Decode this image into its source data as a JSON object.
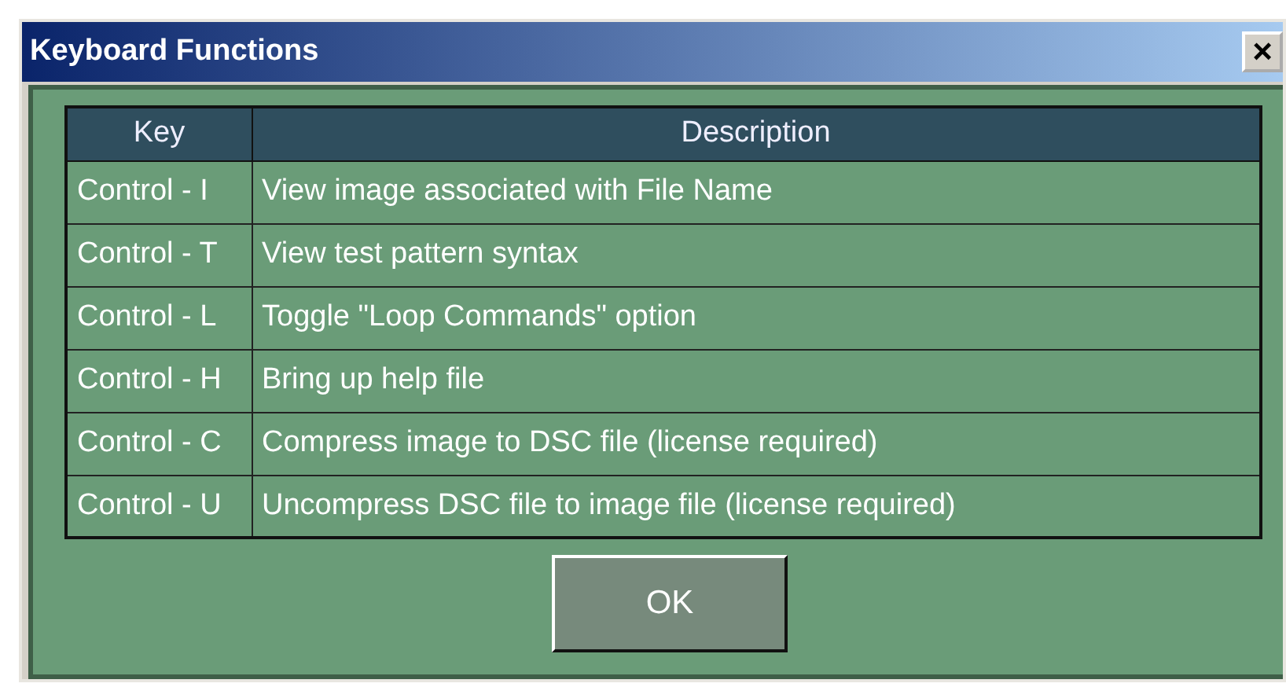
{
  "window": {
    "title": "Keyboard Functions",
    "close": "×"
  },
  "table": {
    "columns": [
      "Key",
      "Description"
    ],
    "rows": [
      [
        "Control - I",
        "View image associated with File Name"
      ],
      [
        "Control - T",
        "View test pattern syntax"
      ],
      [
        "Control - L",
        "Toggle \"Loop Commands\" option"
      ],
      [
        "Control - H",
        "Bring up help file"
      ],
      [
        "Control - C",
        "Compress image to DSC file (license required)"
      ],
      [
        "Control - U",
        "Uncompress DSC file to image file (license required)"
      ]
    ]
  },
  "buttons": [
    "OK"
  ]
}
